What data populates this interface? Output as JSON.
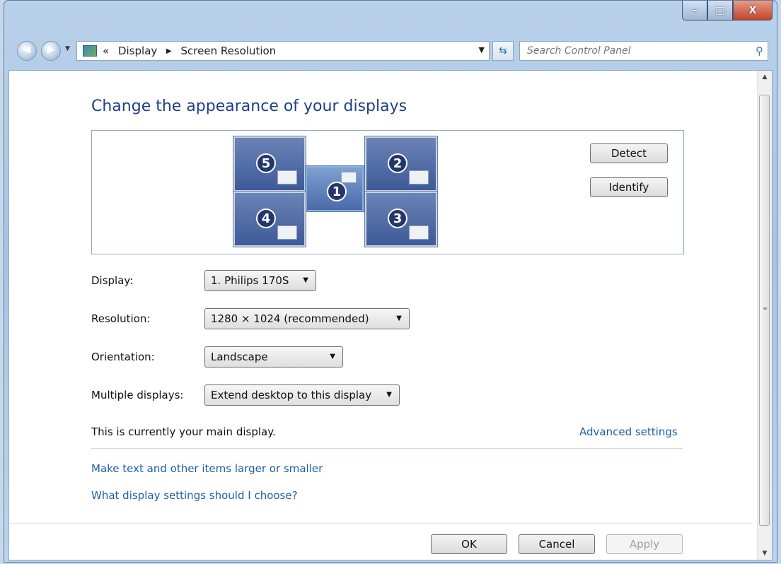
{
  "window": {
    "controls": {
      "minimize": "–",
      "maximize": "□",
      "close": "X"
    }
  },
  "address": {
    "history_glyph": "«",
    "crumbs": [
      "Display",
      "Screen Resolution"
    ],
    "search_placeholder": "Search Control Panel"
  },
  "page": {
    "title": "Change the appearance of your displays"
  },
  "monitors": [
    {
      "number": "5"
    },
    {
      "number": "2"
    },
    {
      "number": "1"
    },
    {
      "number": "4"
    },
    {
      "number": "3"
    }
  ],
  "buttons": {
    "detect": "Detect",
    "identify": "Identify",
    "ok": "OK",
    "cancel": "Cancel",
    "apply": "Apply"
  },
  "form": {
    "display_label": "Display:",
    "display_value": "1. Philips 170S",
    "resolution_label": "Resolution:",
    "resolution_value": "1280 × 1024 (recommended)",
    "orientation_label": "Orientation:",
    "orientation_value": "Landscape",
    "multiple_label": "Multiple displays:",
    "multiple_value": "Extend desktop to this display"
  },
  "status_text": "This is currently your main display.",
  "links": {
    "advanced": "Advanced settings",
    "text_size": "Make text and other items larger or smaller",
    "help": "What display settings should I choose?"
  },
  "colors": {
    "title_blue": "#1e3f8a",
    "link_blue": "#1e5ea8"
  }
}
